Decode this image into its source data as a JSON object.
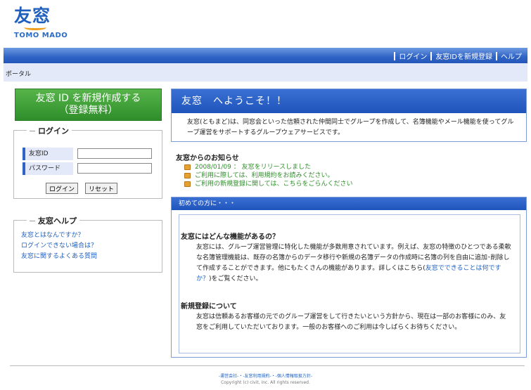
{
  "logo": {
    "mark": "友窓",
    "text": "TOMO MADO"
  },
  "header": {
    "nav": [
      "ログイン",
      "友窓IDを新規登録",
      "ヘルプ"
    ],
    "breadcrumb": "ポータル"
  },
  "register": {
    "line1": "友窓 ID を新規作成する",
    "line2": "（登録無料）"
  },
  "login": {
    "title": "ログイン",
    "id_label": "友窓ID",
    "password_label": "パスワード",
    "id_value": "",
    "password_value": "",
    "login_button": "ログイン",
    "reset_button": "リセット"
  },
  "help": {
    "title": "友窓ヘルプ",
    "links": [
      "友窓とはなんですか？",
      "ログインできない場合は？",
      "友窓に関するよくある質問"
    ]
  },
  "welcome": {
    "title": "友窓　へようこそ！！",
    "body": "友窓(ともまど)は、同窓会といった信頼された仲間同士でグループを作成して、名簿機能やメール機能を使ってグループ運営をサポートするグループウェアサービスです。"
  },
  "news": {
    "title": "友窓からのお知らせ",
    "items": [
      "2008/01/09 ： 友窓をリリースしました",
      "ご利用に際しては、利用規約をお読みください。",
      "ご利用の新規登録に関しては、こちらをごらんください"
    ]
  },
  "intro": {
    "bar": "初めての方に・・・",
    "section1_title": "友窓にはどんな機能があるの？",
    "section1_body_before": "友窓には、グループ運営管理に特化した機能が多数用意されています。例えば、友窓の特徴のひとつである柔軟な名簿管理機能は、既存の名簿からのデータ移行や新規の名簿データの作成時に名簿の列を自由に追加･削除して作成することができます。他にもたくさんの機能があります。詳しくはこちら(",
    "section1_link": "友窓でできることは何ですか？",
    "section1_body_after": ")をご覧ください。",
    "section2_title": "新規登録について",
    "section2_body": "友窓は信頼あるお客様の元でのグループ運営をして行きたいという方針から、現在は一部のお客様にのみ、友窓をご利用していただいております。一般のお客様へのご利用は今しばらくお待ちください。"
  },
  "footer": {
    "links": "-運営会社-・-友窓利用規約-・-個人情報取扱方針-",
    "copyright": "Copyright (c) civit, inc. All rights reserved."
  }
}
